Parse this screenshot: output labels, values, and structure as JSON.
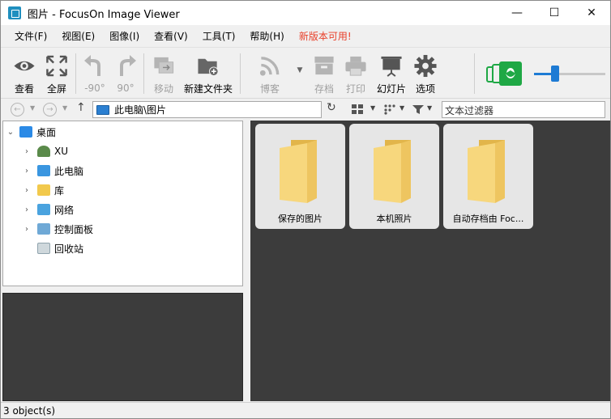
{
  "window": {
    "title": "图片 - FocusOn Image Viewer",
    "controls": {
      "minimize": "—",
      "maximize": "☐",
      "close": "✕"
    }
  },
  "menu": [
    {
      "label": "文件(F)"
    },
    {
      "label": "视图(E)"
    },
    {
      "label": "图像(I)"
    },
    {
      "label": "查看(V)"
    },
    {
      "label": "工具(T)"
    },
    {
      "label": "帮助(H)"
    },
    {
      "label": "新版本可用!"
    }
  ],
  "colors": {
    "accent": "#e8402a",
    "slider": "#1e7bd4",
    "thumbnail_icon": "#1fa845"
  },
  "toolbar": {
    "view": "查看",
    "fullscreen": "全屏",
    "rotate_left": "-90°",
    "rotate_right": "90°",
    "move": "移动",
    "new_folder": "新建文件夹",
    "blog": "博客",
    "archive": "存档",
    "print": "打印",
    "slideshow": "幻灯片",
    "options": "选项",
    "zoom_level": 0.3
  },
  "address": {
    "path": "此电脑\\图片",
    "filter_placeholder": "文本过滤器"
  },
  "tree": {
    "root": "桌面",
    "items": [
      {
        "label": "XU"
      },
      {
        "label": "此电脑"
      },
      {
        "label": "库"
      },
      {
        "label": "网络"
      },
      {
        "label": "控制面板"
      },
      {
        "label": "回收站"
      }
    ]
  },
  "folders": [
    {
      "label": "保存的图片"
    },
    {
      "label": "本机照片"
    },
    {
      "label": "自动存档由 Foc..."
    }
  ],
  "status": {
    "text": "3 object(s)"
  }
}
